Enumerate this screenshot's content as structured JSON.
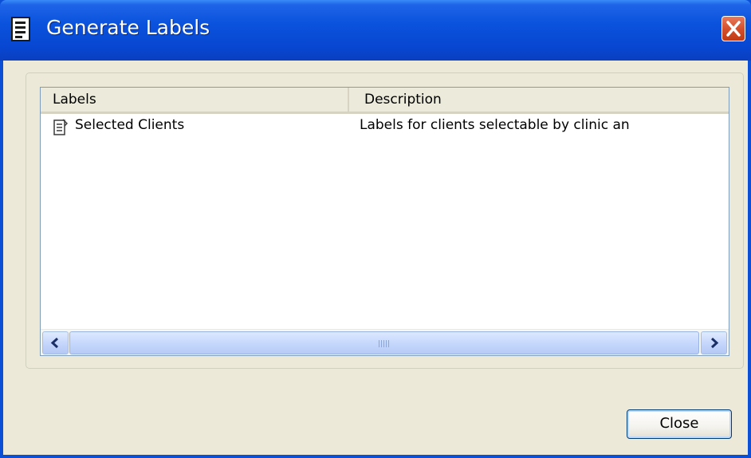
{
  "window": {
    "title": "Generate Labels"
  },
  "listview": {
    "columns": [
      "Labels",
      "Description"
    ],
    "rows": [
      {
        "label": "Selected Clients",
        "description": "Labels for clients selectable by clinic an"
      }
    ]
  },
  "buttons": {
    "close_label": "Close"
  },
  "icons": {
    "title": "document-icon",
    "row": "report-icon",
    "close": "close-icon",
    "scroll_left": "arrow-left-icon",
    "scroll_right": "arrow-right-icon"
  },
  "colors": {
    "titlebar": "#0a52dc",
    "client_bg": "#ece9d8",
    "close_button": "#d4502c"
  }
}
